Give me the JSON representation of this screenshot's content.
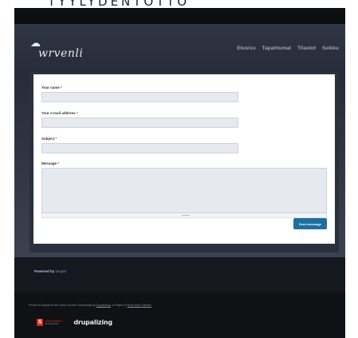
{
  "caption": "TYYLYDENTOTTO",
  "site": {
    "brand": "wrvenli",
    "nav": [
      "Etusivu",
      "Tapahtumat",
      "Tilastot",
      "Seikku"
    ]
  },
  "form": {
    "fields": [
      {
        "label": "Your name",
        "req": "*",
        "value": ""
      },
      {
        "label": "Your e-mail address",
        "req": "*",
        "value": ""
      },
      {
        "label": "Subject",
        "req": "*",
        "value": ""
      }
    ],
    "message": {
      "label": "Message",
      "req": "*",
      "value": ""
    },
    "send_label": "Send message"
  },
  "powered": {
    "prefix": "Powered by",
    "link": "Drupal"
  },
  "footer": {
    "credit_1": "Ported to Drupal for the Open Source Community by",
    "credit_link_1": "Drupalizing",
    "credit_2": ", a Project of",
    "credit_link_2": "More than Themes",
    "badge_smashing": "SMASHING",
    "badge_smashing_sub": "MAGAZINE",
    "badge_drupalizing": "drupalizing"
  },
  "colors": {
    "accent": "#1f6f9e",
    "required": "#d22222",
    "smashing": "#e2231a"
  }
}
